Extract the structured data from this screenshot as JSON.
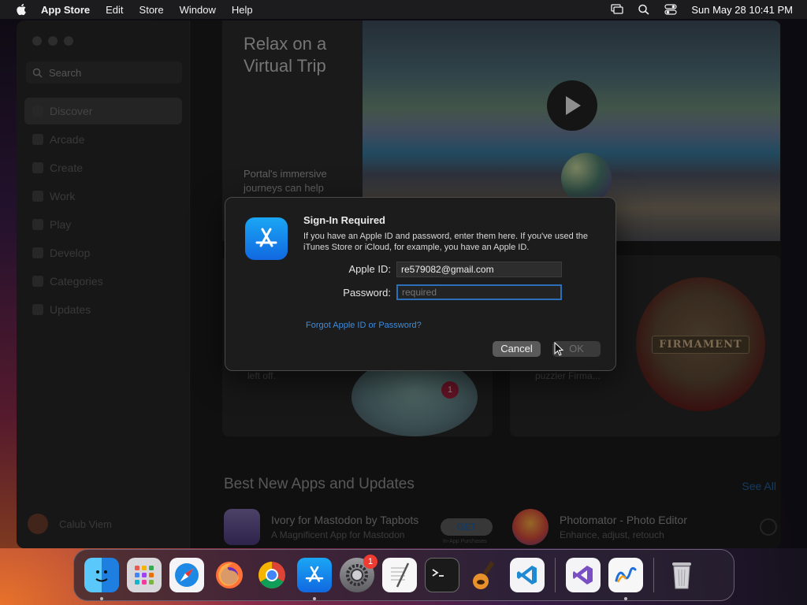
{
  "menubar": {
    "app_name": "App Store",
    "menus": [
      "Edit",
      "Store",
      "Window",
      "Help"
    ],
    "clock": "Sun May 28  10:41 PM"
  },
  "sidebar": {
    "search_placeholder": "Search",
    "items": [
      {
        "label": "Discover"
      },
      {
        "label": "Arcade"
      },
      {
        "label": "Create"
      },
      {
        "label": "Work"
      },
      {
        "label": "Play"
      },
      {
        "label": "Develop"
      },
      {
        "label": "Categories"
      },
      {
        "label": "Updates"
      }
    ],
    "user_name": "Calub Viem"
  },
  "main": {
    "hero": {
      "title": "Relax on a Virtual Trip",
      "text": "Portal's immersive journeys can help"
    },
    "card1_text": "left off.",
    "card1_badge": "1",
    "card2_text": "puzzler Firma...",
    "card2_art_label": "FIRMAMENT",
    "section_title": "Best New Apps and Updates",
    "see_all": "See All",
    "apps": [
      {
        "name": "Ivory for Mastodon by Tapbots",
        "subtitle": "A Magnificent App for Mastodon",
        "button": "GET",
        "button_note": "In-App Purchases"
      },
      {
        "name": "Photomator - Photo Editor",
        "subtitle": "Enhance, adjust, retouch"
      }
    ]
  },
  "dialog": {
    "title": "Sign-In Required",
    "message": "If you have an Apple ID and password, enter them here. If you've used the iTunes Store or iCloud, for example, you have an Apple ID.",
    "apple_id_label": "Apple ID:",
    "apple_id_value": "re579082@gmail.com",
    "password_label": "Password:",
    "password_placeholder": "required",
    "forgot_link": "Forgot Apple ID or Password?",
    "cancel_label": "Cancel",
    "ok_label": "OK"
  },
  "dock": {
    "settings_badge": "1",
    "items": [
      "finder-icon",
      "launchpad-icon",
      "safari-icon",
      "firefox-icon",
      "chrome-icon",
      "app-store-icon",
      "system-settings-icon",
      "textedit-icon",
      "terminal-icon",
      "garageband-icon",
      "vscode-icon",
      "visual-studio-icon",
      "freeform-icon",
      "trash-icon"
    ]
  },
  "colors": {
    "accent": "#2c6fb8",
    "link": "#3a8ce0",
    "app_store_blue": "#1168e0",
    "badge_red": "#ef3b32"
  }
}
